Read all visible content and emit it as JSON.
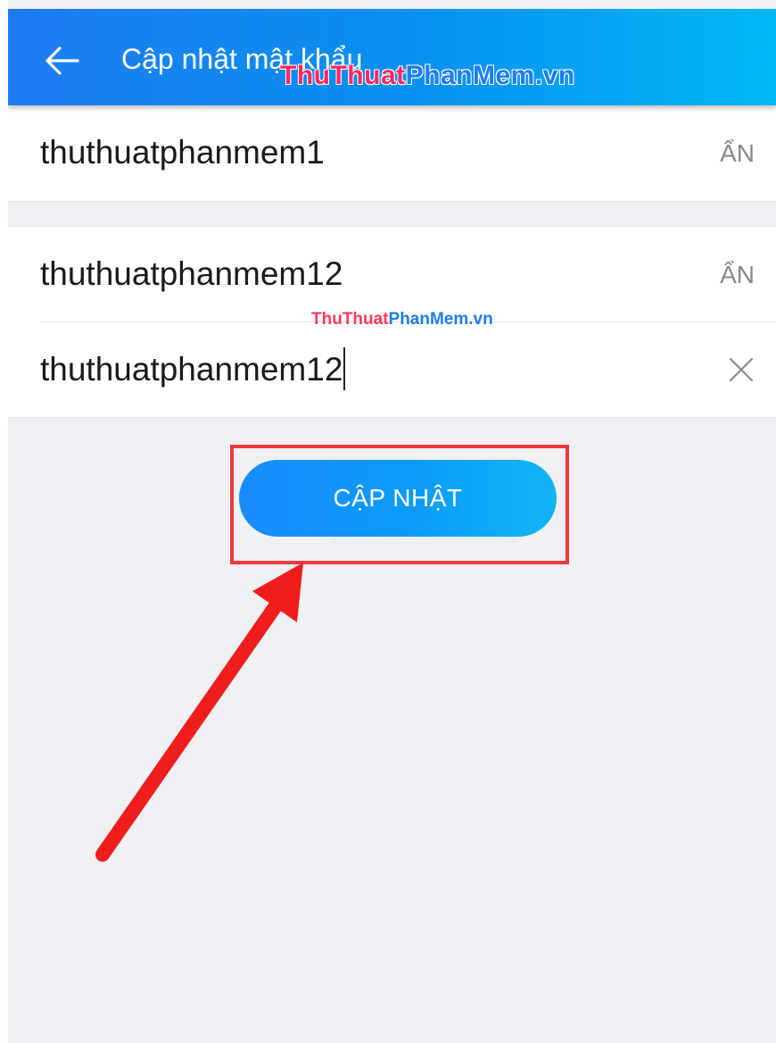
{
  "header": {
    "title": "Cập nhật mật khẩu",
    "back_icon": "arrow-left-icon"
  },
  "watermark": {
    "part1": "ThuThuat",
    "part2": "PhanMem.vn"
  },
  "fields": {
    "current_password": {
      "value": "thuthuatphanmem1",
      "action_label": "ẨN"
    },
    "new_password": {
      "value": "thuthuatphanmem12",
      "action_label": "ẨN"
    },
    "confirm_password": {
      "value": "thuthuatphanmem12",
      "clear_icon": "close-icon"
    }
  },
  "update_button": {
    "label": "CẬP NHẬT"
  },
  "colors": {
    "header_start": "#1e7cf2",
    "header_end": "#00b7f5",
    "button": "#1a8cff",
    "highlight": "#ee3a3a",
    "background": "#f0f1f4"
  }
}
